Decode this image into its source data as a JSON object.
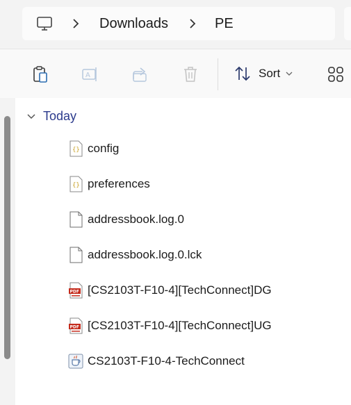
{
  "breadcrumb": {
    "items": [
      "Downloads",
      "PE"
    ]
  },
  "toolbar": {
    "sort_label": "Sort"
  },
  "file_list": {
    "group_label": "Today",
    "files": [
      {
        "name": "config",
        "icon": "json-file-icon"
      },
      {
        "name": "preferences",
        "icon": "json-file-icon"
      },
      {
        "name": "addressbook.log.0",
        "icon": "generic-file-icon"
      },
      {
        "name": "addressbook.log.0.lck",
        "icon": "generic-file-icon"
      },
      {
        "name": "[CS2103T-F10-4][TechConnect]DG",
        "icon": "pdf-file-icon"
      },
      {
        "name": "[CS2103T-F10-4][TechConnect]UG",
        "icon": "pdf-file-icon"
      },
      {
        "name": "CS2103T-F10-4-TechConnect",
        "icon": "java-jar-icon"
      }
    ]
  },
  "colors": {
    "accent": "#2b3a8c",
    "pdf_red": "#c42b1c",
    "json_gold": "#c9a227"
  }
}
